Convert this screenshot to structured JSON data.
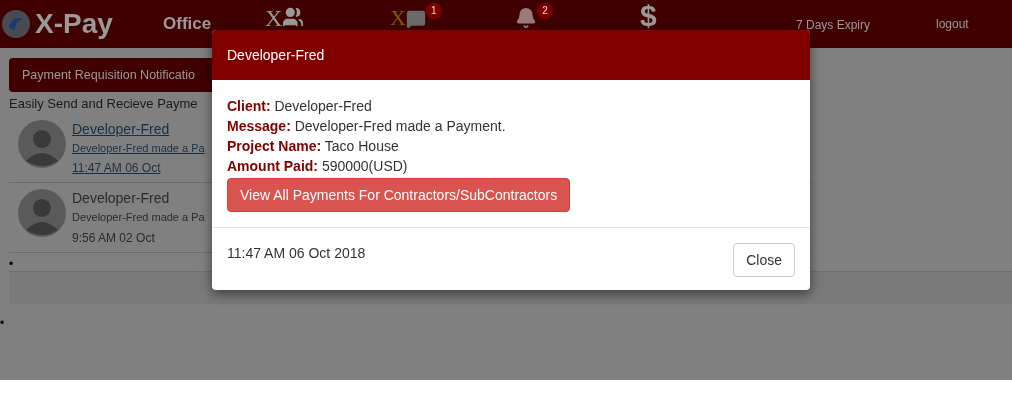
{
  "navbar": {
    "brand": "X-Pay",
    "items": [
      {
        "kind": "text",
        "label": "Office"
      },
      {
        "kind": "users",
        "prefix": "X"
      },
      {
        "kind": "messages",
        "prefix": "X",
        "badge": "1"
      },
      {
        "kind": "bell",
        "badge": "2"
      },
      {
        "kind": "text",
        "label": "$"
      }
    ],
    "expiry": "7 Days Expiry",
    "logout": "logout"
  },
  "requisition_button": "Payment Requisition Notificatio",
  "tagline": "Easily Send and Recieve Payme",
  "notifications": [
    {
      "kind": "link",
      "name": "Developer-Fred",
      "message": "Developer-Fred made a Pa",
      "time": "11:47 AM 06 Oct"
    },
    {
      "kind": "plain",
      "name": "Developer-Fred",
      "message": "Developer-Fred made a Pa",
      "time": "9:56 AM 02 Oct"
    }
  ],
  "list_markers": [
    "•",
    "•"
  ],
  "modal": {
    "title": "Developer-Fred",
    "fields": [
      {
        "label": "Client:",
        "value": "Developer-Fred"
      },
      {
        "label": "Message:",
        "value": "Developer-Fred made a Payment."
      },
      {
        "label": "Project Name:",
        "value": "Taco House"
      },
      {
        "label": "Amount Paid:",
        "value": "590000(USD)"
      }
    ],
    "action": "View All Payments For Contractors/SubContractors",
    "timestamp": "11:47 AM 06 Oct 2018",
    "close": "Close"
  }
}
